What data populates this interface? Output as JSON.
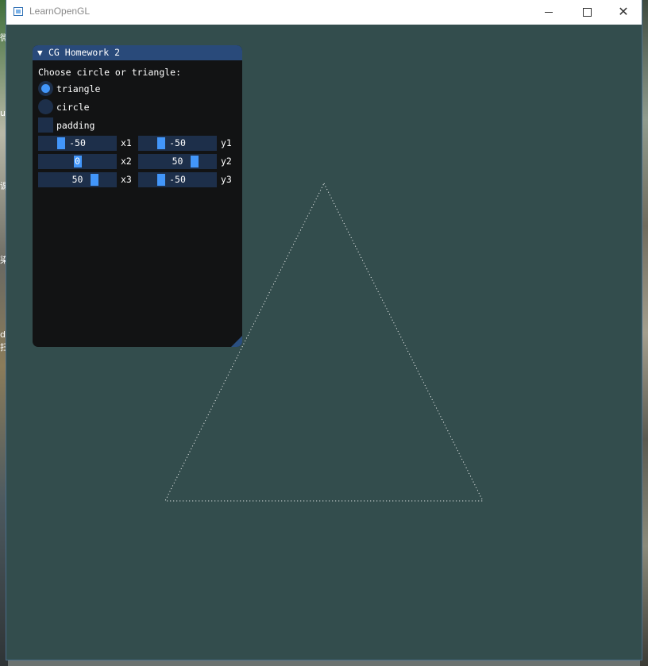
{
  "window": {
    "title": "LearnOpenGL",
    "controls": [
      "minimize-icon",
      "maximize-icon",
      "close-icon"
    ],
    "close_glyph": "✕"
  },
  "desktop": {
    "left_glyphs": [
      "微",
      "u",
      "课",
      "染",
      "d",
      "扫"
    ]
  },
  "viewport": {
    "background": "#334d4d",
    "shape": "triangle",
    "line_color": "#ffffff"
  },
  "panel": {
    "title": "CG Homework 2",
    "collapse_arrow": "▼",
    "prompt": "Choose circle or triangle:",
    "options": [
      {
        "label": "triangle",
        "selected": true
      },
      {
        "label": "circle",
        "selected": false
      }
    ],
    "checkbox": {
      "label": "padding",
      "checked": false
    },
    "sliders": [
      {
        "label": "x1",
        "value": -50,
        "display": "-50",
        "grab_fraction": 0.25
      },
      {
        "label": "y1",
        "value": -50,
        "display": "-50",
        "grab_fraction": 0.25
      },
      {
        "label": "x2",
        "value": 0,
        "display": "0",
        "grab_fraction": 0.5
      },
      {
        "label": "y2",
        "value": 50,
        "display": "50",
        "grab_fraction": 0.75
      },
      {
        "label": "x3",
        "value": 50,
        "display": "50",
        "grab_fraction": 0.75
      },
      {
        "label": "y3",
        "value": -50,
        "display": "-50",
        "grab_fraction": 0.25
      }
    ],
    "accent": "#4296fa",
    "frame_bg": "#1d2f4a",
    "title_bg": "#294a7a"
  }
}
